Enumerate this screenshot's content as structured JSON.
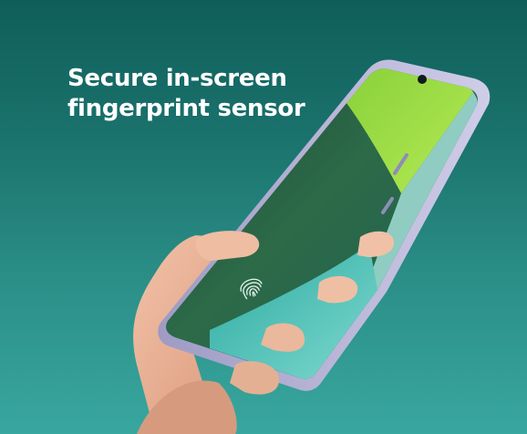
{
  "headline": {
    "line1": "Secure in-screen",
    "line2": "fingerprint sensor"
  },
  "colors": {
    "background_top": "#0f5e5a",
    "background_bottom": "#38a79f",
    "headline_text": "#ffffff",
    "phone_frame": "#b6b3d6",
    "screen_accent_green": "#9fe03c",
    "screen_accent_teal": "#39c0b6"
  },
  "icons": {
    "fingerprint": "fingerprint-icon",
    "camera": "front-camera-icon"
  }
}
